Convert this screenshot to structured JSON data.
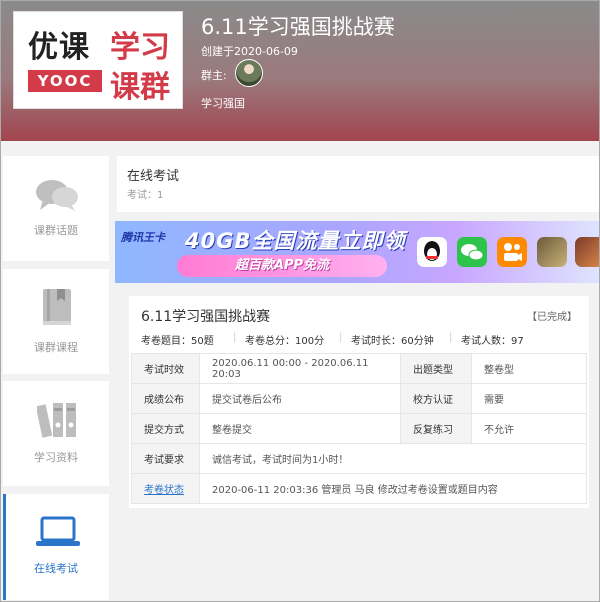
{
  "logo": {
    "top_left": "优课",
    "top_right": "学习",
    "badge": "YOOC",
    "bottom_right": "课群"
  },
  "header": {
    "title": "6.11学习强国挑战赛",
    "created": "创建于2020-06-09",
    "owner_label": "群主:",
    "group_name": "学习强国"
  },
  "sidebar": {
    "items": [
      {
        "label": "课群话题",
        "icon": "chat-bubbles-icon"
      },
      {
        "label": "课群课程",
        "icon": "book-icon"
      },
      {
        "label": "学习资料",
        "icon": "binders-icon"
      },
      {
        "label": "在线考试",
        "icon": "laptop-icon"
      }
    ],
    "active_index": 3
  },
  "section": {
    "title": "在线考试",
    "count_label": "考试：",
    "count": "1"
  },
  "banner": {
    "brand": "腾讯王卡",
    "headline": "40GB全国流量立即领",
    "pill": "超百款APP免流",
    "apps": [
      "qq-icon",
      "wechat-icon",
      "kuaishou-icon",
      "game-icon",
      "game-icon-2"
    ]
  },
  "exam": {
    "title": "6.11学习强国挑战赛",
    "status": "【已完成】",
    "meta": [
      {
        "label": "考卷题目：",
        "value": "50题"
      },
      {
        "label": "考卷总分：",
        "value": "100分"
      },
      {
        "label": "考试时长：",
        "value": "60分钟"
      },
      {
        "label": "考试人数：",
        "value": "97"
      }
    ],
    "rows": [
      {
        "k1": "考试时效",
        "v1": "2020.06.11 00:00 - 2020.06.11 20:03",
        "k2": "出题类型",
        "v2": "整卷型"
      },
      {
        "k1": "成绩公布",
        "v1": "提交试卷后公布",
        "k2": "校方认证",
        "v2": "需要"
      },
      {
        "k1": "提交方式",
        "v1": "整卷提交",
        "k2": "反复练习",
        "v2": "不允许"
      }
    ],
    "requirement_label": "考试要求",
    "requirement": "诚信考试，考试时间为1小时！",
    "paper_status_label": "考卷状态",
    "paper_status": "2020-06-11 20:03:36 管理员 马良 修改过考卷设置或题目内容"
  },
  "colors": {
    "accent": "#2a74c9",
    "brand_red": "#d33b49",
    "alert_red": "#e0262b"
  }
}
